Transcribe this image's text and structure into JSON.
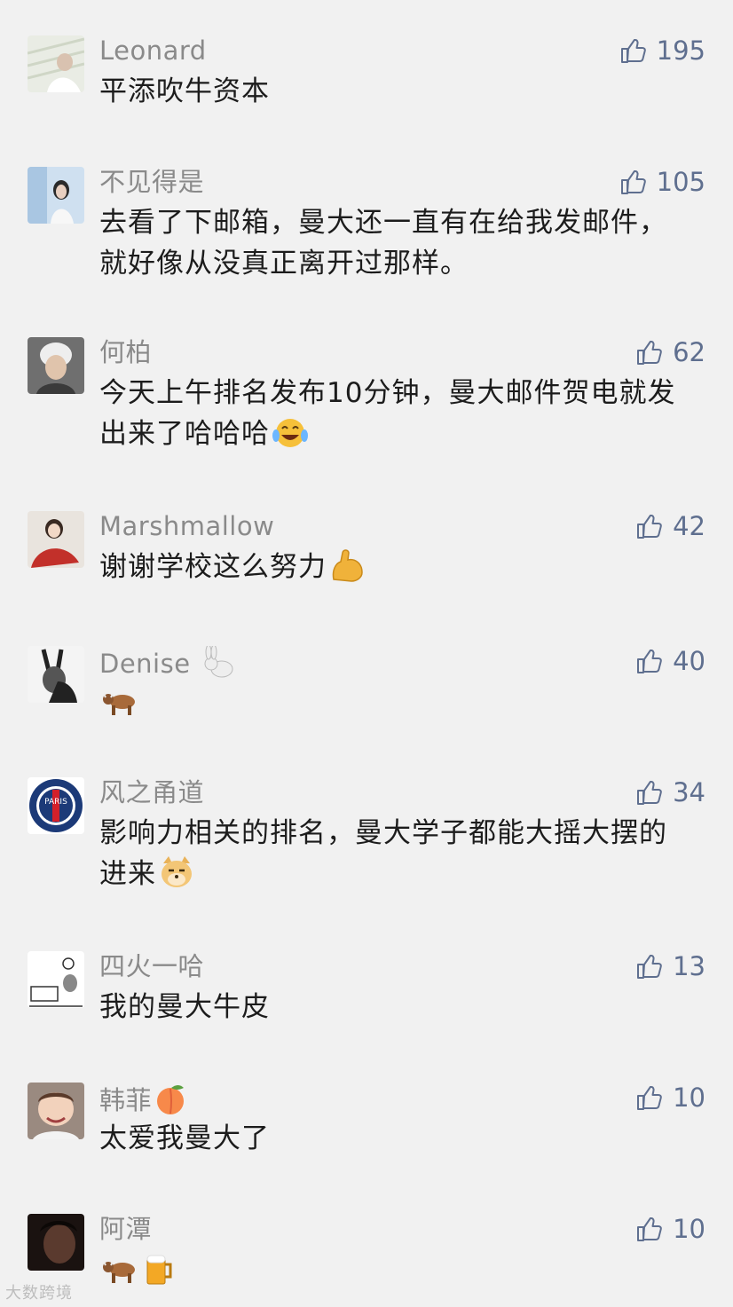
{
  "comments": [
    {
      "name": "Leonard",
      "likes": "195",
      "text": "平添吹牛资本"
    },
    {
      "name": "不见得是",
      "likes": "105",
      "text": "去看了下邮箱，曼大还一直有在给我发邮件，",
      "text2": "就好像从没真正离开过那样。"
    },
    {
      "name": "何柏",
      "likes": "62",
      "text": "今天上午排名发布10分钟，曼大邮件贺电就发",
      "text2": "出来了哈哈哈"
    },
    {
      "name": "Marshmallow",
      "likes": "42",
      "text": "谢谢学校这么努力"
    },
    {
      "name": "Denise",
      "likes": "40",
      "text": ""
    },
    {
      "name": "风之甬道",
      "likes": "34",
      "text": "影响力相关的排名，曼大学子都能大摇大摆的",
      "text2": "进来"
    },
    {
      "name": "四火一哈",
      "likes": "13",
      "text": "我的曼大牛皮"
    },
    {
      "name": "韩菲",
      "likes": "10",
      "text": "太爱我曼大了"
    },
    {
      "name": "阿潭",
      "likes": "10",
      "text": ""
    }
  ],
  "avatar_badges": {
    "psg": "PARIS"
  },
  "watermark": "大数跨境",
  "icons": {
    "like": "thumbs-up-icon",
    "emoji": [
      "tears-of-joy-emoji",
      "flexed-biceps-emoji",
      "rabbit-emoji",
      "ox-emoji",
      "doge-emoji",
      "peach-emoji",
      "beer-emoji"
    ]
  },
  "colors": {
    "background": "#f1f1f1",
    "name": "#8a8a8a",
    "like": "#5f6f8f",
    "text": "#1c1c1c"
  }
}
